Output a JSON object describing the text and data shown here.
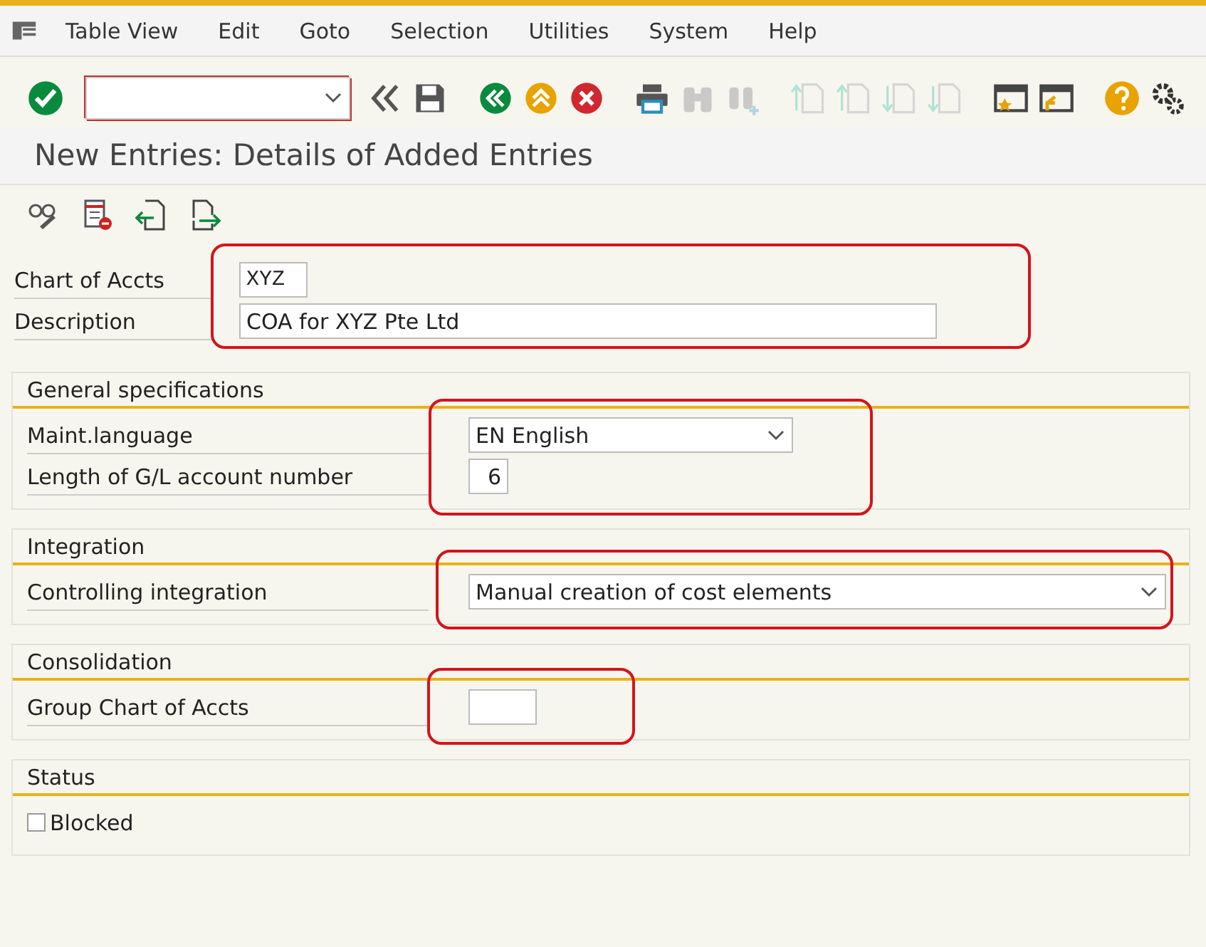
{
  "menu_bar": {
    "items": [
      {
        "label": "Table View"
      },
      {
        "label": "Edit"
      },
      {
        "label": "Goto"
      },
      {
        "label": "Selection"
      },
      {
        "label": "Utilities"
      },
      {
        "label": "System"
      },
      {
        "label": "Help"
      }
    ]
  },
  "toolbar": {
    "buttons": [
      {
        "kind": "back-double",
        "disabled": false
      },
      {
        "kind": "save",
        "disabled": false
      },
      {
        "kind": "back",
        "disabled": false
      },
      {
        "kind": "exit",
        "disabled": false
      },
      {
        "kind": "cancel",
        "disabled": false
      },
      {
        "kind": "print",
        "disabled": false
      },
      {
        "kind": "find",
        "disabled": true
      },
      {
        "kind": "find-next",
        "disabled": true
      },
      {
        "kind": "first-page",
        "disabled": true
      },
      {
        "kind": "prev-page",
        "disabled": true
      },
      {
        "kind": "next-page",
        "disabled": true
      },
      {
        "kind": "last-page",
        "disabled": true
      },
      {
        "kind": "new-session",
        "disabled": false
      },
      {
        "kind": "shortcut",
        "disabled": false
      },
      {
        "kind": "help",
        "disabled": false
      },
      {
        "kind": "settings",
        "disabled": false
      }
    ]
  },
  "title": "New Entries: Details of Added Entries",
  "app_toolbar": [
    {
      "kind": "display-change"
    },
    {
      "kind": "delete"
    },
    {
      "kind": "previous"
    },
    {
      "kind": "next"
    }
  ],
  "header": {
    "highlighted": true,
    "fields": [
      {
        "kind": "code",
        "label": "Chart of Accts",
        "value": "XYZ"
      },
      {
        "kind": "text",
        "label": "Description",
        "value": "COA for XYZ Pte Ltd"
      }
    ]
  },
  "groups": [
    {
      "title": "General specifications",
      "highlighted": true,
      "fields": [
        {
          "kind": "dropdown",
          "label": "Maint.language",
          "value": "EN English"
        },
        {
          "kind": "number",
          "label": "Length of G/L account number",
          "value": "6"
        }
      ]
    },
    {
      "title": "Integration",
      "highlighted": true,
      "fields": [
        {
          "kind": "dropdown",
          "label": "Controlling integration",
          "value": "Manual creation of cost elements"
        }
      ]
    },
    {
      "title": "Consolidation",
      "highlighted": true,
      "fields": [
        {
          "kind": "code",
          "label": "Group Chart of Accts"
        }
      ]
    },
    {
      "title": "Status",
      "fields": [
        {
          "kind": "checkbox",
          "label": "Blocked",
          "checked": false
        }
      ]
    }
  ]
}
